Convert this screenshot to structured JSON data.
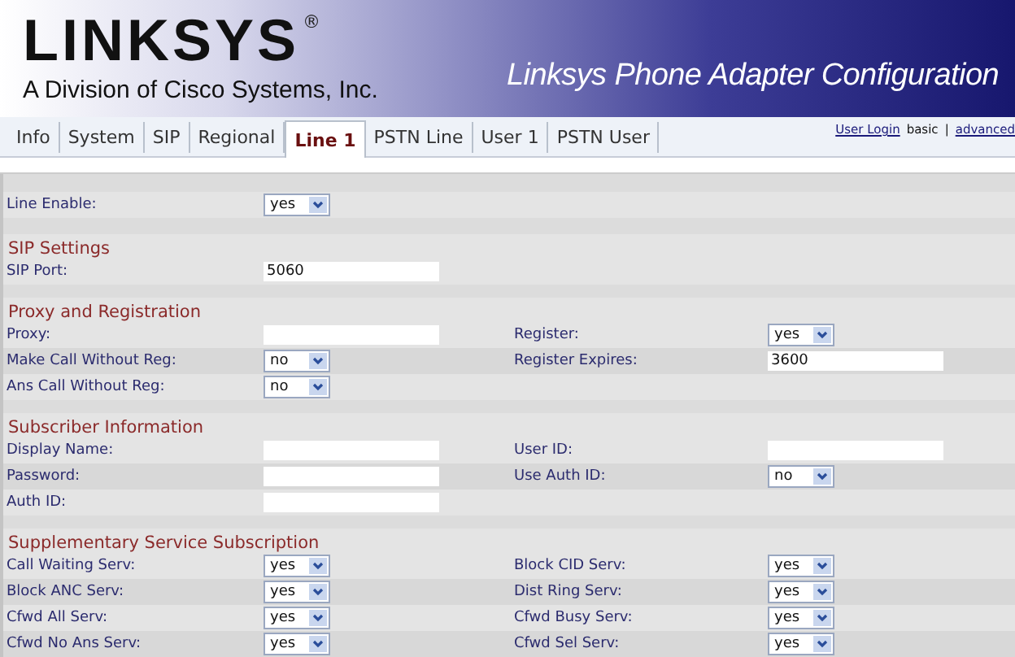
{
  "header": {
    "logo": "LINKSYS",
    "logo_mark": "®",
    "tagline": "A Division of Cisco Systems, Inc.",
    "title": "Linksys Phone Adapter Configuration"
  },
  "tabs": [
    {
      "label": "Info",
      "selected": false
    },
    {
      "label": "System",
      "selected": false
    },
    {
      "label": "SIP",
      "selected": false
    },
    {
      "label": "Regional",
      "selected": false
    },
    {
      "label": "Line 1",
      "selected": true
    },
    {
      "label": "PSTN Line",
      "selected": false
    },
    {
      "label": "User 1",
      "selected": false
    },
    {
      "label": "PSTN User",
      "selected": false
    }
  ],
  "links": [
    {
      "kind": "link",
      "text": "User Login"
    },
    {
      "kind": "plain",
      "text": "basic"
    },
    {
      "kind": "plain",
      "text": "|"
    },
    {
      "kind": "link",
      "text": "advanced"
    }
  ],
  "sections": [
    {
      "rows": [
        {
          "left": {
            "label": "Line Enable:",
            "kind": "select",
            "value": "yes"
          }
        }
      ]
    },
    {
      "title": "SIP Settings",
      "rows": [
        {
          "left": {
            "label": "SIP Port:",
            "kind": "text",
            "value": "5060"
          }
        }
      ]
    },
    {
      "title": "Proxy and Registration",
      "rows": [
        {
          "left": {
            "label": "Proxy:",
            "kind": "text"
          },
          "right": {
            "label": "Register:",
            "kind": "select",
            "value": "yes"
          }
        },
        {
          "left": {
            "label": "Make Call Without Reg:",
            "kind": "select",
            "value": "no"
          },
          "right": {
            "label": "Register Expires:",
            "kind": "text",
            "value": "3600"
          }
        },
        {
          "left": {
            "label": "Ans Call Without Reg:",
            "kind": "select",
            "value": "no"
          }
        }
      ]
    },
    {
      "title": "Subscriber Information",
      "rows": [
        {
          "left": {
            "label": "Display Name:",
            "kind": "text"
          },
          "right": {
            "label": "User ID:",
            "kind": "text"
          }
        },
        {
          "left": {
            "label": "Password:",
            "kind": "text"
          },
          "right": {
            "label": "Use Auth ID:",
            "kind": "select",
            "value": "no"
          }
        },
        {
          "left": {
            "label": "Auth ID:",
            "kind": "text"
          }
        }
      ]
    },
    {
      "title": "Supplementary Service Subscription",
      "rows": [
        {
          "left": {
            "label": "Call Waiting Serv:",
            "kind": "select",
            "value": "yes"
          },
          "right": {
            "label": "Block CID Serv:",
            "kind": "select",
            "value": "yes"
          }
        },
        {
          "left": {
            "label": "Block ANC Serv:",
            "kind": "select",
            "value": "yes"
          },
          "right": {
            "label": "Dist Ring Serv:",
            "kind": "select",
            "value": "yes"
          }
        },
        {
          "left": {
            "label": "Cfwd All Serv:",
            "kind": "select",
            "value": "yes"
          },
          "right": {
            "label": "Cfwd Busy Serv:",
            "kind": "select",
            "value": "yes"
          }
        },
        {
          "left": {
            "label": "Cfwd No Ans Serv:",
            "kind": "select",
            "value": "yes"
          },
          "right": {
            "label": "Cfwd Sel Serv:",
            "kind": "select",
            "value": "yes"
          }
        }
      ]
    }
  ]
}
